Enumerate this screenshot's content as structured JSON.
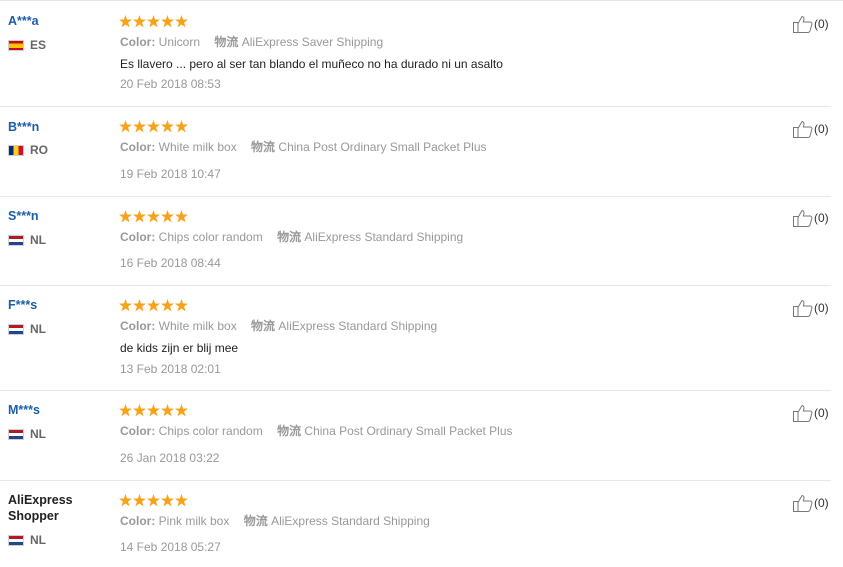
{
  "labels": {
    "color": "Color:",
    "shipping": "物流"
  },
  "reviews": [
    {
      "user": "A***a",
      "country": "ES",
      "color": "Unicorn",
      "shipping": "AliExpress Saver Shipping",
      "feedback": "Es llavero ... pero al ser tan blando el muñeco no ha durado ni un asalto",
      "date": "20 Feb 2018 08:53",
      "helpful": "(0)",
      "stars": 5
    },
    {
      "user": "B***n",
      "country": "RO",
      "color": "White milk box",
      "shipping": "China Post Ordinary Small Packet Plus",
      "feedback": "",
      "date": "19 Feb 2018 10:47",
      "helpful": "(0)",
      "stars": 5
    },
    {
      "user": "S***n",
      "country": "NL",
      "color": "Chips color random",
      "shipping": "AliExpress Standard Shipping",
      "feedback": "",
      "date": "16 Feb 2018 08:44",
      "helpful": "(0)",
      "stars": 5
    },
    {
      "user": "F***s",
      "country": "NL",
      "color": "White milk box",
      "shipping": "AliExpress Standard Shipping",
      "feedback": "de kids zijn er blij mee",
      "date": "13 Feb 2018 02:01",
      "helpful": "(0)",
      "stars": 5
    },
    {
      "user": "M***s",
      "country": "NL",
      "color": "Chips color random",
      "shipping": "China Post Ordinary Small Packet Plus",
      "feedback": "",
      "date": "26 Jan 2018 03:22",
      "helpful": "(0)",
      "stars": 5
    },
    {
      "user_line1": "AliExpress",
      "user_line2": "Shopper",
      "country": "NL",
      "color": "Pink milk box",
      "shipping": "AliExpress Standard Shipping",
      "feedback": "",
      "date": "14 Feb 2018 05:27",
      "helpful": "(0)",
      "stars": 5
    }
  ]
}
